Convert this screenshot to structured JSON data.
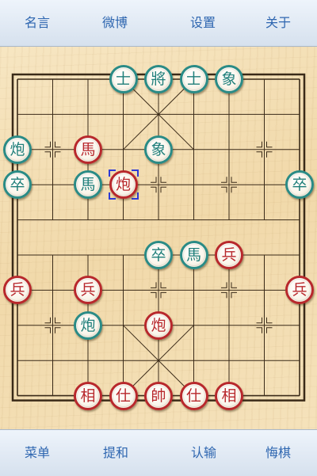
{
  "top_menu": {
    "quotes": "名言",
    "weibo": "微博",
    "settings": "设置",
    "about": "关于"
  },
  "bottom_menu": {
    "menu": "菜单",
    "draw": "提和",
    "resign": "认输",
    "undo": "悔棋"
  },
  "colors": {
    "red_side": "#b8282c",
    "green_side": "#2a8b86",
    "board_line": "#3a2a18",
    "selection": "#2d3ad6",
    "menu_text": "#2e66b0"
  },
  "board": {
    "files": 9,
    "ranks": 10,
    "selected": {
      "file": 3,
      "rank": 3
    },
    "pieces": [
      {
        "char": "士",
        "side": "green",
        "file": 3,
        "rank": 0
      },
      {
        "char": "將",
        "side": "green",
        "file": 4,
        "rank": 0
      },
      {
        "char": "士",
        "side": "green",
        "file": 5,
        "rank": 0
      },
      {
        "char": "象",
        "side": "green",
        "file": 6,
        "rank": 0
      },
      {
        "char": "炮",
        "side": "green",
        "file": 0,
        "rank": 2
      },
      {
        "char": "馬",
        "side": "red",
        "file": 2,
        "rank": 2
      },
      {
        "char": "象",
        "side": "green",
        "file": 4,
        "rank": 2
      },
      {
        "char": "卒",
        "side": "green",
        "file": 0,
        "rank": 3
      },
      {
        "char": "馬",
        "side": "green",
        "file": 2,
        "rank": 3
      },
      {
        "char": "炮",
        "side": "red",
        "file": 3,
        "rank": 3
      },
      {
        "char": "卒",
        "side": "green",
        "file": 8,
        "rank": 3
      },
      {
        "char": "卒",
        "side": "green",
        "file": 4,
        "rank": 5
      },
      {
        "char": "馬",
        "side": "green",
        "file": 5,
        "rank": 5
      },
      {
        "char": "兵",
        "side": "red",
        "file": 6,
        "rank": 5
      },
      {
        "char": "兵",
        "side": "red",
        "file": 0,
        "rank": 6
      },
      {
        "char": "兵",
        "side": "red",
        "file": 2,
        "rank": 6
      },
      {
        "char": "兵",
        "side": "red",
        "file": 8,
        "rank": 6
      },
      {
        "char": "炮",
        "side": "green",
        "file": 2,
        "rank": 7
      },
      {
        "char": "炮",
        "side": "red",
        "file": 4,
        "rank": 7
      },
      {
        "char": "相",
        "side": "red",
        "file": 2,
        "rank": 9
      },
      {
        "char": "仕",
        "side": "red",
        "file": 3,
        "rank": 9
      },
      {
        "char": "帥",
        "side": "red",
        "file": 4,
        "rank": 9
      },
      {
        "char": "仕",
        "side": "red",
        "file": 5,
        "rank": 9
      },
      {
        "char": "相",
        "side": "red",
        "file": 6,
        "rank": 9
      }
    ]
  }
}
